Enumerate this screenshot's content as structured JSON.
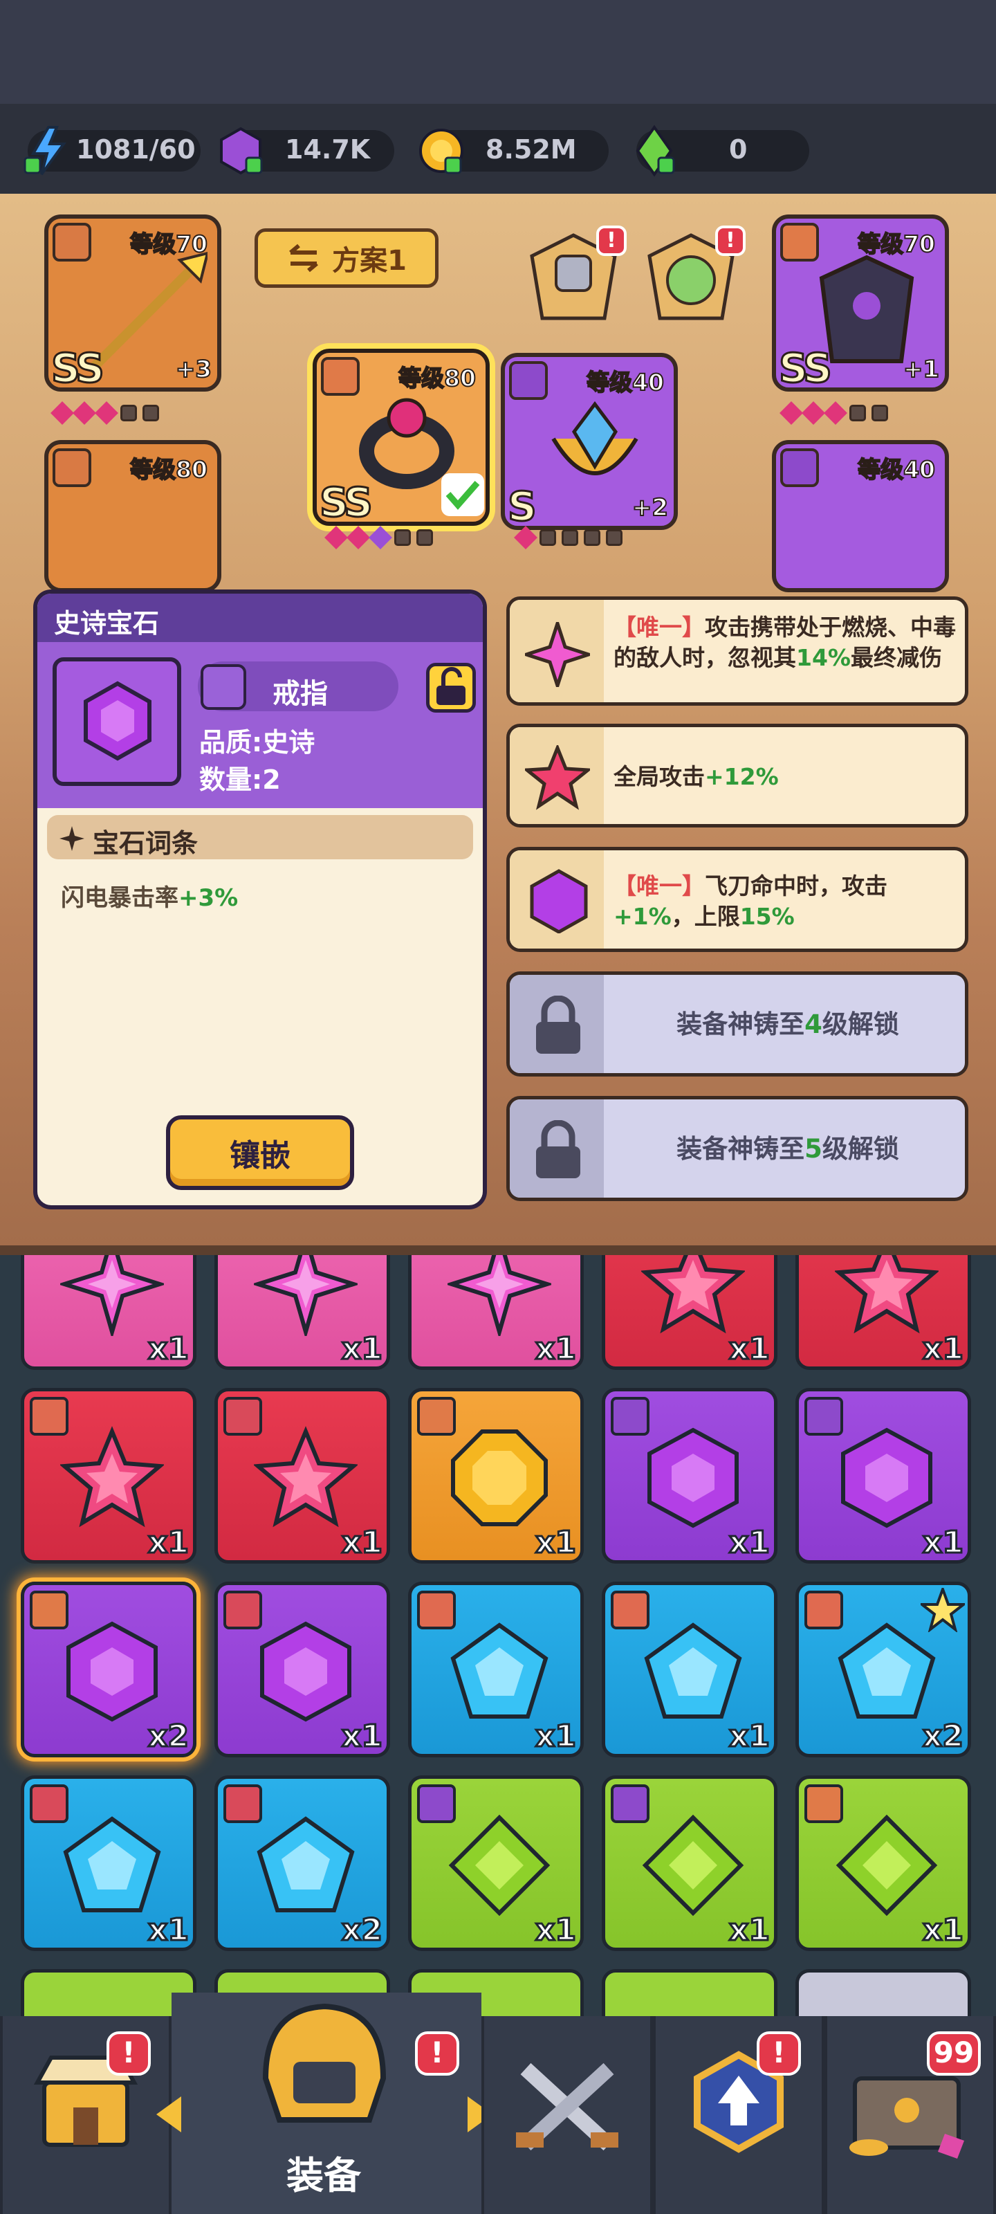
{
  "resources": {
    "energy": "1081/60",
    "gems": "14.7K",
    "gold": "8.52M",
    "crystal": "0"
  },
  "scheme_button": "方案1",
  "slots": {
    "left_top": {
      "level": "等级70",
      "grade": "SS",
      "plus": "+3"
    },
    "left_mid": {
      "level": "等级80"
    },
    "popup_ring": {
      "level": "等级80",
      "grade": "SS"
    },
    "popup_amulet": {
      "level": "等级40",
      "grade": "S",
      "plus": "+2"
    },
    "right_top": {
      "level": "等级70",
      "grade": "SS",
      "plus": "+1"
    },
    "right_mid": {
      "level": "等级40"
    }
  },
  "detail": {
    "title": "史诗宝石",
    "type": "戒指",
    "quality": "品质:史诗",
    "quantity": "数量:2",
    "affix_header": "宝石词条",
    "affix_name": "闪电暴击率",
    "affix_value": "+3%",
    "embed_button": "镶嵌"
  },
  "effects": [
    {
      "tag": "【唯一】",
      "p1": "攻击携带处于燃烧、中毒的敌人时，忽视其",
      "v1": "14%",
      "p2": "最终减伤"
    },
    {
      "p1": "全局攻击",
      "v1": "+12%"
    },
    {
      "tag": "【唯一】",
      "p1": "飞刀命中时，攻击",
      "v1": "+1%",
      "p2": "，上限",
      "v2": "15%"
    }
  ],
  "locked": [
    {
      "pre": "装备神铸至",
      "num": "4",
      "post": "级解锁"
    },
    {
      "pre": "装备神铸至",
      "num": "5",
      "post": "级解锁"
    }
  ],
  "inventory": [
    {
      "gem": "star4",
      "bg": "pink",
      "count": "x1"
    },
    {
      "gem": "star4",
      "bg": "pink",
      "count": "x1"
    },
    {
      "gem": "star4",
      "bg": "pink",
      "count": "x1"
    },
    {
      "gem": "star",
      "bg": "red",
      "count": "x1"
    },
    {
      "gem": "star",
      "bg": "red",
      "count": "x1"
    },
    {
      "gem": "star",
      "bg": "red",
      "tag": "armor",
      "count": "x1"
    },
    {
      "gem": "star",
      "bg": "red",
      "tag": "sword",
      "count": "x1"
    },
    {
      "gem": "octagon",
      "bg": "orange",
      "tag": "ring",
      "count": "x1"
    },
    {
      "gem": "hexagon",
      "bg": "purple",
      "tag": "necklace",
      "count": "x1"
    },
    {
      "gem": "hexagon",
      "bg": "purple",
      "tag": "necklace",
      "count": "x1"
    },
    {
      "gem": "hexagon",
      "bg": "purple",
      "tag": "ring",
      "count": "x2",
      "selected": true
    },
    {
      "gem": "hexagon",
      "bg": "purple",
      "tag": "sword",
      "count": "x1"
    },
    {
      "gem": "pentagon",
      "bg": "blue",
      "tag": "armor",
      "count": "x1"
    },
    {
      "gem": "pentagon",
      "bg": "blue",
      "tag": "armor",
      "count": "x1"
    },
    {
      "gem": "pentagon",
      "bg": "blue",
      "tag": "armor",
      "count": "x2",
      "star": true
    },
    {
      "gem": "pentagon",
      "bg": "blue",
      "tag": "sword",
      "count": "x1"
    },
    {
      "gem": "pentagon",
      "bg": "blue",
      "tag": "sword",
      "count": "x2"
    },
    {
      "gem": "diamond",
      "bg": "green",
      "tag": "necklace",
      "count": "x1"
    },
    {
      "gem": "diamond",
      "bg": "green",
      "tag": "necklace",
      "count": "x1"
    },
    {
      "gem": "diamond",
      "bg": "green",
      "tag": "ring",
      "count": "x1"
    }
  ],
  "nav": {
    "equip_label": "装备",
    "chest_badge": "99",
    "alert": "!"
  }
}
